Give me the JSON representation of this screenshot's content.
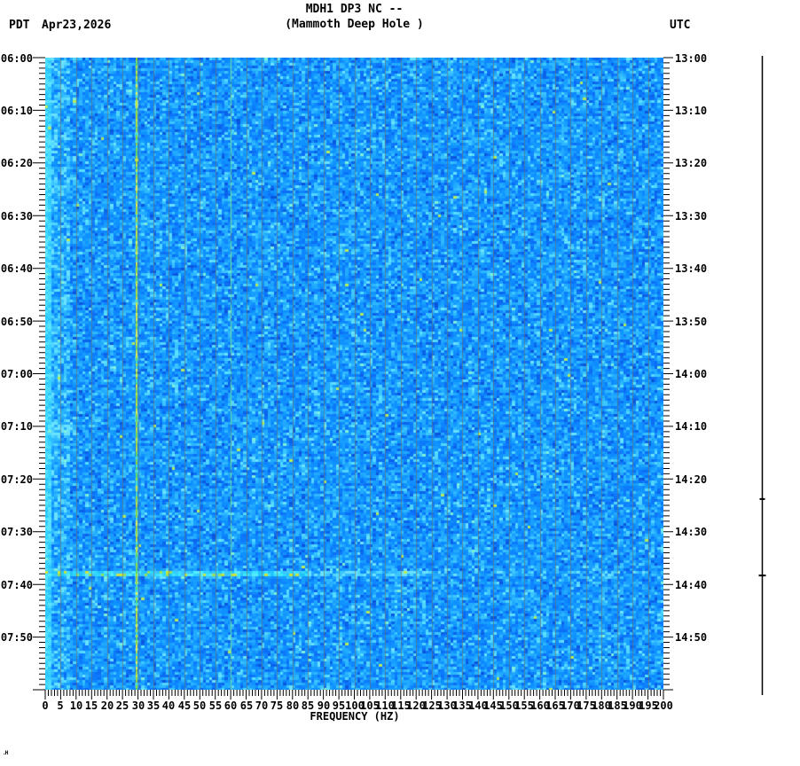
{
  "header": {
    "title_line1": "MDH1 DP3 NC --",
    "title_line2": "(Mammoth Deep Hole )",
    "left_timezone": "PDT",
    "date": "Apr23,2026",
    "right_timezone": "UTC"
  },
  "corner_mark": ".H",
  "chart_data": {
    "type": "heatmap",
    "subtype": "seismic-spectrogram",
    "title": "MDH1 DP3 NC -- (Mammoth Deep Hole )",
    "xlabel": "FREQUENCY (HZ)",
    "x_range_hz": [
      0,
      200
    ],
    "x_major_tick_step_hz": 5,
    "x_minor_tick_step_hz": 1,
    "x_tick_labels": [
      "0",
      "5",
      "10",
      "15",
      "20",
      "25",
      "30",
      "35",
      "40",
      "45",
      "50",
      "55",
      "60",
      "65",
      "70",
      "75",
      "80",
      "85",
      "90",
      "95",
      "100",
      "105",
      "110",
      "115",
      "120",
      "125",
      "130",
      "135",
      "140",
      "145",
      "150",
      "155",
      "160",
      "165",
      "170",
      "175",
      "180",
      "185",
      "190",
      "195",
      "200"
    ],
    "y_axis_left": {
      "timezone": "PDT",
      "date": "Apr23,2026",
      "start": "06:00",
      "end": "08:00",
      "major_tick_step_min": 10,
      "minor_tick_step_min": 1,
      "tick_labels": [
        "06:00",
        "06:10",
        "06:20",
        "06:30",
        "06:40",
        "06:50",
        "07:00",
        "07:10",
        "07:20",
        "07:30",
        "07:40",
        "07:50"
      ]
    },
    "y_axis_right": {
      "timezone": "UTC",
      "start": "13:00",
      "end": "15:00",
      "major_tick_step_min": 10,
      "minor_tick_step_min": 1,
      "tick_labels": [
        "13:00",
        "13:10",
        "13:20",
        "13:30",
        "13:40",
        "13:50",
        "14:00",
        "14:10",
        "14:20",
        "14:30",
        "14:40",
        "14:50"
      ]
    },
    "legend_position": "none",
    "grid": "5 Hz faint vertical binning stripes",
    "background_noise_color_range": [
      "#0a55dd",
      "#6ae2ff"
    ],
    "palette_blue": [
      "#0a55dd",
      "#0b62ea",
      "#0c6ef4",
      "#0d7afc",
      "#0e86ff",
      "#0f92ff",
      "#189eff",
      "#22aaff",
      "#2eb8ff",
      "#3cc6ff",
      "#52d6ff",
      "#6ae2ff"
    ],
    "stripe_color": "rgba(105,112,100,0.6)",
    "line30_colors": [
      "#cde43e",
      "#b2de3a",
      "#99d838",
      "#7fd94e",
      "#62d967",
      "#e8ee52",
      "#49e0c8"
    ],
    "line60_colors": [
      "#6fdc9a",
      "#58d8a8",
      "#7ee28c"
    ],
    "event_bright_colors": [
      "#3fe4ff",
      "#2ed8ff",
      "#55ecff",
      "#22c4ff"
    ],
    "event_warm_colors": [
      "#cde43e",
      "#9be05a"
    ],
    "low_freq_colors": [
      "#38d2ff",
      "#4adcff",
      "#2cc6ff",
      "#5ae4ff"
    ],
    "features": [
      {
        "name": "persistent-line-30hz",
        "frequency_hz": 29.4,
        "color": "#cde43e",
        "description": "bright yellow-green vertical line near 30 Hz spanning the full two hours"
      },
      {
        "name": "powerline-noise-60hz",
        "frequency_hz": 60,
        "color": "#6fdc9a",
        "description": "faint green vertical line at 60 Hz"
      },
      {
        "name": "binning-stripes",
        "step_hz": 5,
        "description": "thin dark-gray vertical stripes every 5 Hz"
      },
      {
        "name": "low-frequency-band",
        "frequency_hz": "0-2",
        "description": "persistent bright cyan energy along left edge (microseism)"
      },
      {
        "name": "event-broadband",
        "time_pdt": "07:38",
        "time_utc": "14:38",
        "description": "horizontal bright broadband line (seismic event), strongest below ~85 Hz, fading by ~125 Hz"
      },
      {
        "name": "event-minor",
        "time_pdt": "07:24",
        "time_utc": "14:24",
        "description": "small blip visible on side amplitude trace"
      },
      {
        "name": "low-freq-patch",
        "time_pdt": "07:10",
        "description": "brighter low-frequency patch near 07:10"
      }
    ],
    "side_trace": {
      "description": "vertical seismogram amplitude trace at right edge",
      "events": [
        {
          "time_pdt": "07:24",
          "amplitude": "small"
        },
        {
          "time_pdt": "07:38",
          "amplitude": "moderate"
        }
      ]
    }
  }
}
